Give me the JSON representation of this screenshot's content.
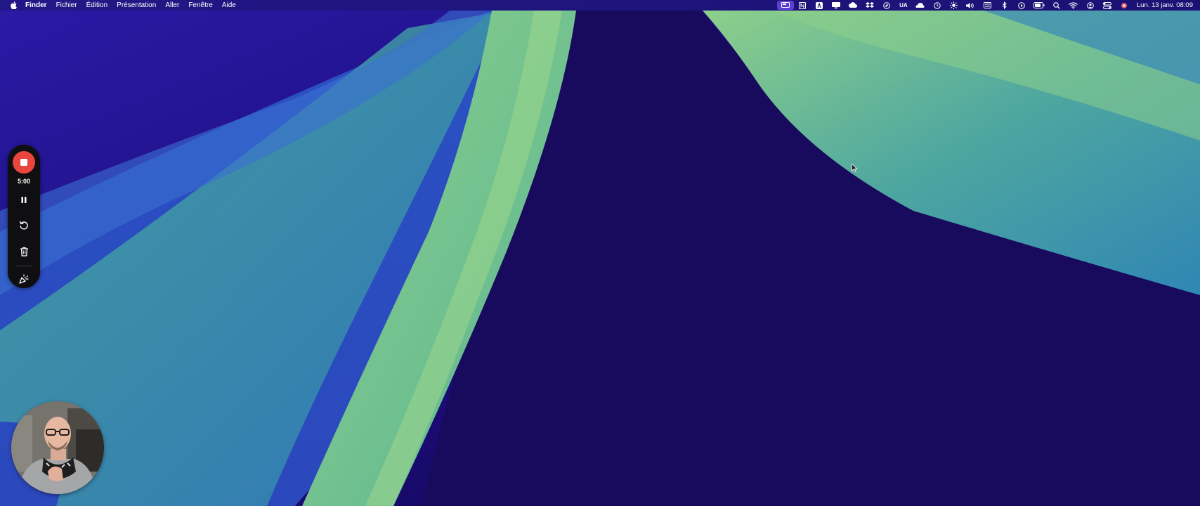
{
  "menubar": {
    "apple_icon": "apple-logo-icon",
    "app_name": "Finder",
    "menus": [
      "Fichier",
      "Édition",
      "Présentation",
      "Aller",
      "Fenêtre",
      "Aide"
    ],
    "tray_text_ua": "UA",
    "clock": "Lun. 13 janv.  08:09"
  },
  "recorder": {
    "timer": "5:00",
    "accent_color": "#e8453c",
    "icons": [
      "stop-icon",
      "pause-icon",
      "restart-icon",
      "trash-icon",
      "effects-icon"
    ]
  },
  "colors": {
    "wallpaper_dark": "#1c0c6e",
    "wallpaper_green": "#8ed08a",
    "wallpaper_teal": "#3fa0a0",
    "active_tray": "#5b3fd6"
  }
}
